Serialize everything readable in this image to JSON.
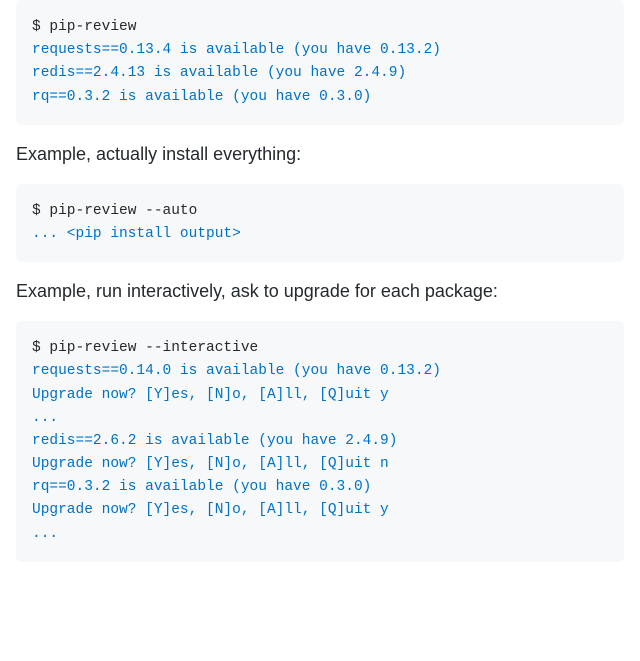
{
  "block1": {
    "line1_prompt": "$ ",
    "line1_cmd": "pip-review",
    "line2": "requests==0.13.4 is available (you have 0.13.2)",
    "line3": "redis==2.4.13 is available (you have 2.4.9)",
    "line4": "rq==0.3.2 is available (you have 0.3.0)"
  },
  "prose1": "Example, actually install everything:",
  "block2": {
    "line1_prompt": "$ ",
    "line1_cmd": "pip-review --auto",
    "line2": "... <pip install output>"
  },
  "prose2": "Example, run interactively, ask to upgrade for each package:",
  "block3": {
    "line1_prompt": "$ ",
    "line1_cmd": "pip-review --interactive",
    "line2": "requests==0.14.0 is available (you have 0.13.2)",
    "line3": "Upgrade now? [Y]es, [N]o, [A]ll, [Q]uit y",
    "line4": "...",
    "line5": "redis==2.6.2 is available (you have 2.4.9)",
    "line6": "Upgrade now? [Y]es, [N]o, [A]ll, [Q]uit n",
    "line7": "rq==0.3.2 is available (you have 0.3.0)",
    "line8": "Upgrade now? [Y]es, [N]o, [A]ll, [Q]uit y",
    "line9": "..."
  }
}
